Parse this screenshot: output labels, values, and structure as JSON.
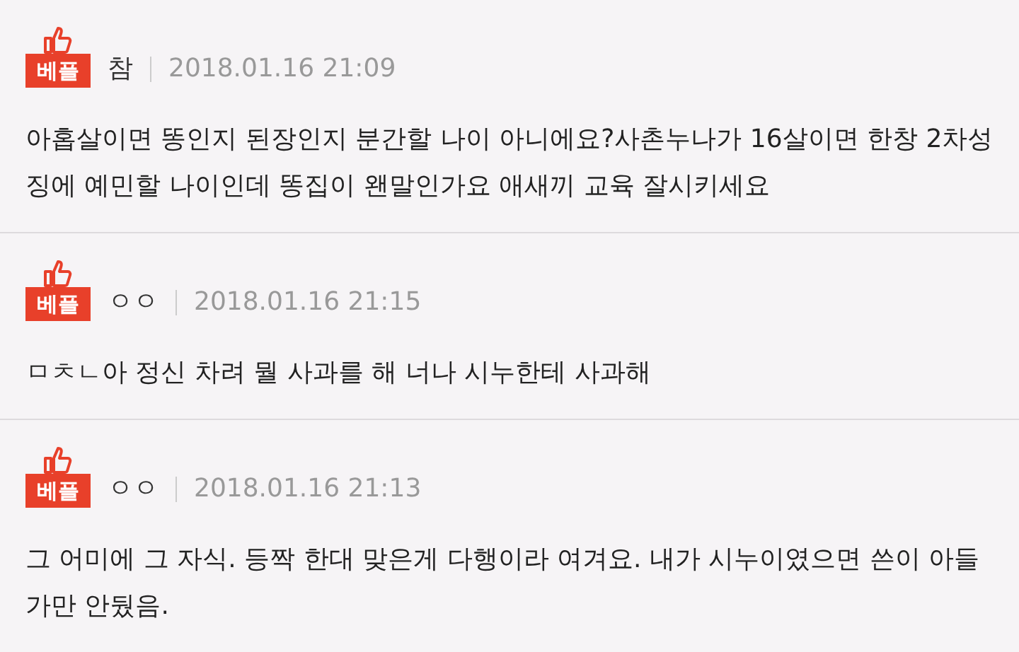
{
  "comments": [
    {
      "badge": "베플",
      "author": "참",
      "date": "2018.01.16 21:09",
      "text": "아홉살이면 똥인지 된장인지 분간할 나이 아니에요?사촌누나가 16살이면 한창 2차성징에 예민할 나이인데 똥집이 왠말인가요 애새끼 교육 잘시키세요"
    },
    {
      "badge": "베플",
      "author": "ㅇㅇ",
      "date": "2018.01.16 21:15",
      "text": "ㅁㅊㄴ아 정신 차려 뭘 사과를 해 너나 시누한테 사과해"
    },
    {
      "badge": "베플",
      "author": "ㅇㅇ",
      "date": "2018.01.16 21:13",
      "text": "그 어미에 그 자식. 등짝 한대 맞은게 다행이라 여겨요. 내가 시누이였으면 쓴이 아들 가만 안뒀음."
    }
  ]
}
